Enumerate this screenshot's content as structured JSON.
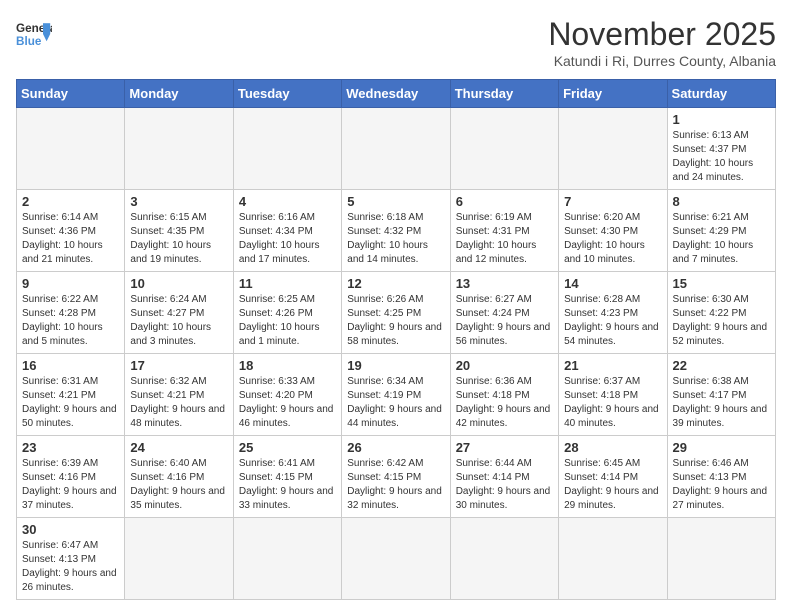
{
  "header": {
    "logo_general": "General",
    "logo_blue": "Blue",
    "month_title": "November 2025",
    "subtitle": "Katundi i Ri, Durres County, Albania"
  },
  "days_of_week": [
    "Sunday",
    "Monday",
    "Tuesday",
    "Wednesday",
    "Thursday",
    "Friday",
    "Saturday"
  ],
  "weeks": [
    [
      {
        "day": "",
        "info": ""
      },
      {
        "day": "",
        "info": ""
      },
      {
        "day": "",
        "info": ""
      },
      {
        "day": "",
        "info": ""
      },
      {
        "day": "",
        "info": ""
      },
      {
        "day": "",
        "info": ""
      },
      {
        "day": "1",
        "info": "Sunrise: 6:13 AM\nSunset: 4:37 PM\nDaylight: 10 hours and 24 minutes."
      }
    ],
    [
      {
        "day": "2",
        "info": "Sunrise: 6:14 AM\nSunset: 4:36 PM\nDaylight: 10 hours and 21 minutes."
      },
      {
        "day": "3",
        "info": "Sunrise: 6:15 AM\nSunset: 4:35 PM\nDaylight: 10 hours and 19 minutes."
      },
      {
        "day": "4",
        "info": "Sunrise: 6:16 AM\nSunset: 4:34 PM\nDaylight: 10 hours and 17 minutes."
      },
      {
        "day": "5",
        "info": "Sunrise: 6:18 AM\nSunset: 4:32 PM\nDaylight: 10 hours and 14 minutes."
      },
      {
        "day": "6",
        "info": "Sunrise: 6:19 AM\nSunset: 4:31 PM\nDaylight: 10 hours and 12 minutes."
      },
      {
        "day": "7",
        "info": "Sunrise: 6:20 AM\nSunset: 4:30 PM\nDaylight: 10 hours and 10 minutes."
      },
      {
        "day": "8",
        "info": "Sunrise: 6:21 AM\nSunset: 4:29 PM\nDaylight: 10 hours and 7 minutes."
      }
    ],
    [
      {
        "day": "9",
        "info": "Sunrise: 6:22 AM\nSunset: 4:28 PM\nDaylight: 10 hours and 5 minutes."
      },
      {
        "day": "10",
        "info": "Sunrise: 6:24 AM\nSunset: 4:27 PM\nDaylight: 10 hours and 3 minutes."
      },
      {
        "day": "11",
        "info": "Sunrise: 6:25 AM\nSunset: 4:26 PM\nDaylight: 10 hours and 1 minute."
      },
      {
        "day": "12",
        "info": "Sunrise: 6:26 AM\nSunset: 4:25 PM\nDaylight: 9 hours and 58 minutes."
      },
      {
        "day": "13",
        "info": "Sunrise: 6:27 AM\nSunset: 4:24 PM\nDaylight: 9 hours and 56 minutes."
      },
      {
        "day": "14",
        "info": "Sunrise: 6:28 AM\nSunset: 4:23 PM\nDaylight: 9 hours and 54 minutes."
      },
      {
        "day": "15",
        "info": "Sunrise: 6:30 AM\nSunset: 4:22 PM\nDaylight: 9 hours and 52 minutes."
      }
    ],
    [
      {
        "day": "16",
        "info": "Sunrise: 6:31 AM\nSunset: 4:21 PM\nDaylight: 9 hours and 50 minutes."
      },
      {
        "day": "17",
        "info": "Sunrise: 6:32 AM\nSunset: 4:21 PM\nDaylight: 9 hours and 48 minutes."
      },
      {
        "day": "18",
        "info": "Sunrise: 6:33 AM\nSunset: 4:20 PM\nDaylight: 9 hours and 46 minutes."
      },
      {
        "day": "19",
        "info": "Sunrise: 6:34 AM\nSunset: 4:19 PM\nDaylight: 9 hours and 44 minutes."
      },
      {
        "day": "20",
        "info": "Sunrise: 6:36 AM\nSunset: 4:18 PM\nDaylight: 9 hours and 42 minutes."
      },
      {
        "day": "21",
        "info": "Sunrise: 6:37 AM\nSunset: 4:18 PM\nDaylight: 9 hours and 40 minutes."
      },
      {
        "day": "22",
        "info": "Sunrise: 6:38 AM\nSunset: 4:17 PM\nDaylight: 9 hours and 39 minutes."
      }
    ],
    [
      {
        "day": "23",
        "info": "Sunrise: 6:39 AM\nSunset: 4:16 PM\nDaylight: 9 hours and 37 minutes."
      },
      {
        "day": "24",
        "info": "Sunrise: 6:40 AM\nSunset: 4:16 PM\nDaylight: 9 hours and 35 minutes."
      },
      {
        "day": "25",
        "info": "Sunrise: 6:41 AM\nSunset: 4:15 PM\nDaylight: 9 hours and 33 minutes."
      },
      {
        "day": "26",
        "info": "Sunrise: 6:42 AM\nSunset: 4:15 PM\nDaylight: 9 hours and 32 minutes."
      },
      {
        "day": "27",
        "info": "Sunrise: 6:44 AM\nSunset: 4:14 PM\nDaylight: 9 hours and 30 minutes."
      },
      {
        "day": "28",
        "info": "Sunrise: 6:45 AM\nSunset: 4:14 PM\nDaylight: 9 hours and 29 minutes."
      },
      {
        "day": "29",
        "info": "Sunrise: 6:46 AM\nSunset: 4:13 PM\nDaylight: 9 hours and 27 minutes."
      }
    ],
    [
      {
        "day": "30",
        "info": "Sunrise: 6:47 AM\nSunset: 4:13 PM\nDaylight: 9 hours and 26 minutes."
      },
      {
        "day": "",
        "info": ""
      },
      {
        "day": "",
        "info": ""
      },
      {
        "day": "",
        "info": ""
      },
      {
        "day": "",
        "info": ""
      },
      {
        "day": "",
        "info": ""
      },
      {
        "day": "",
        "info": ""
      }
    ]
  ]
}
